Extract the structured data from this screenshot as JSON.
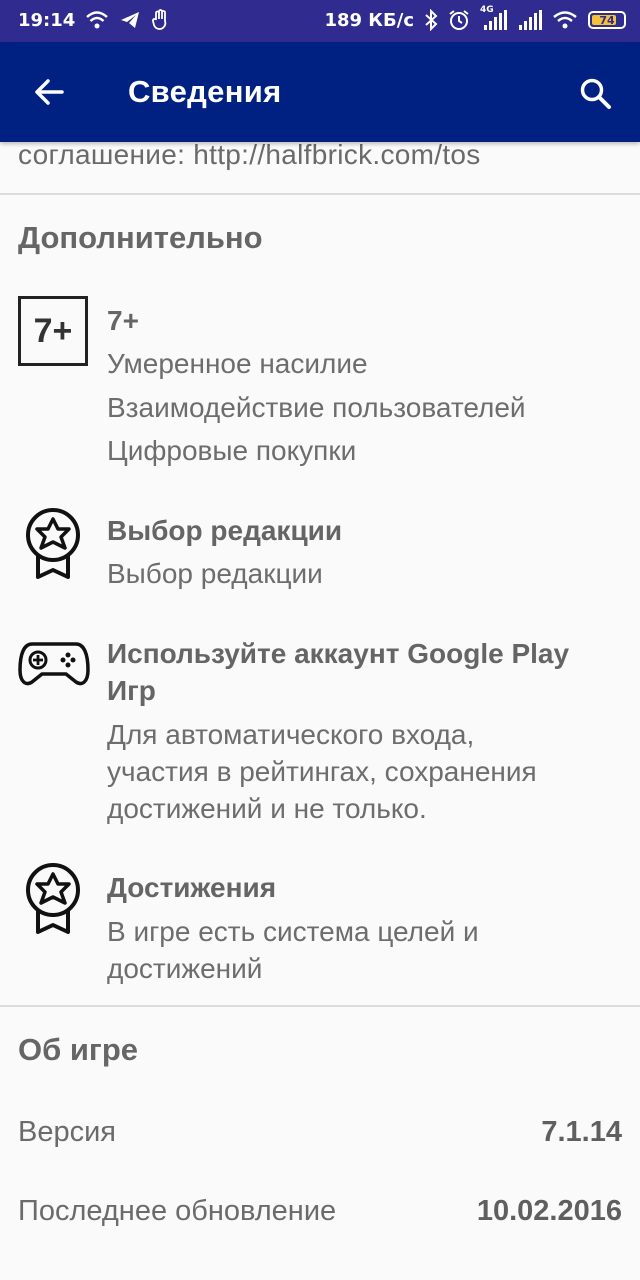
{
  "status_bar": {
    "time": "19:14",
    "net_speed": "189 КБ/с",
    "signal_label": "4G",
    "battery": "74",
    "icons": [
      "wifi-icon",
      "telegram-icon",
      "hand-icon",
      "bluetooth-icon",
      "alarm-icon",
      "signal-icon",
      "signal-icon",
      "wifi-icon",
      "battery-icon"
    ]
  },
  "app_bar": {
    "title": "Сведения",
    "back_icon": "arrow-back-icon",
    "search_icon": "search-icon",
    "color": "#002082"
  },
  "top_partial": "соглашение: http://halfbrick.com/tos",
  "additional": {
    "title": "Дополнительно",
    "rating": {
      "badge": "7+",
      "title": "7+",
      "lines": [
        "Умеренное насилие",
        "Взаимодействие пользователей",
        "Цифровые покупки"
      ]
    },
    "editors_choice": {
      "icon": "award-icon",
      "title": "Выбор редакции",
      "line": "Выбор редакции"
    },
    "google_play_games": {
      "icon": "gamepad-icon",
      "title_lines": [
        "Используйте аккаунт Google Play",
        "Игр"
      ],
      "lines": [
        "Для автоматического входа,",
        "участия в рейтингах, сохранения",
        "достижений и не только."
      ]
    },
    "achievements": {
      "icon": "award-icon",
      "title": "Достижения",
      "lines": [
        "В игре есть система целей и",
        "достижений"
      ]
    }
  },
  "about": {
    "title": "Об игре",
    "rows": [
      {
        "label": "Версия",
        "value": "7.1.14"
      },
      {
        "label": "Последнее обновление",
        "value": "10.02.2016"
      }
    ]
  }
}
